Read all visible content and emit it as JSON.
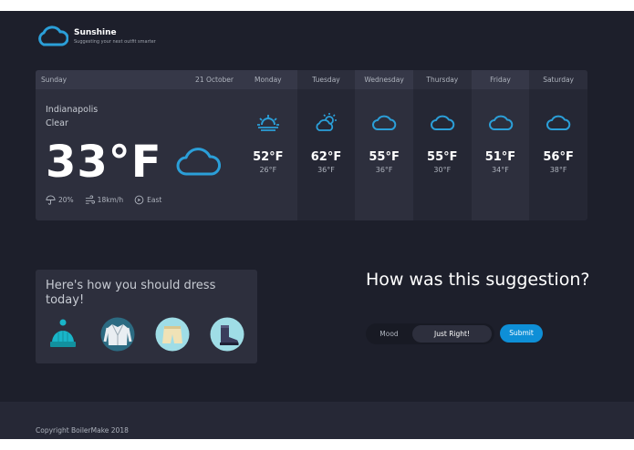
{
  "brand": {
    "title": "Sunshine",
    "subtitle": "Suggesting your next outfit smarter",
    "logo_icon": "cloud-icon",
    "accent_color": "#2b9fd8"
  },
  "today": {
    "day": "Sunday",
    "date": "21 October",
    "city": "Indianapolis",
    "condition": "Clear",
    "temperature": "33°F",
    "icon": "cloud-icon",
    "precipitation": "20%",
    "wind_speed": "18km/h",
    "wind_direction": "East"
  },
  "forecast": [
    {
      "day": "Monday",
      "icon": "sunrise-icon",
      "high": "52°F",
      "low": "26°F"
    },
    {
      "day": "Tuesday",
      "icon": "partly-sunny-icon",
      "high": "62°F",
      "low": "36°F"
    },
    {
      "day": "Wednesday",
      "icon": "cloud-icon",
      "high": "55°F",
      "low": "36°F"
    },
    {
      "day": "Thursday",
      "icon": "cloud-icon",
      "high": "55°F",
      "low": "30°F"
    },
    {
      "day": "Friday",
      "icon": "cloud-icon",
      "high": "51°F",
      "low": "34°F"
    },
    {
      "day": "Saturday",
      "icon": "cloud-icon",
      "high": "56°F",
      "low": "38°F"
    }
  ],
  "dress": {
    "title": "Here's how you should dress today!",
    "items": [
      "beanie-icon",
      "jacket-icon",
      "shorts-icon",
      "boot-icon"
    ]
  },
  "feedback": {
    "title": "How was this suggestion?",
    "mood_label": "Mood",
    "mood_value": "Just Right!",
    "submit_label": "Submit"
  },
  "footer": {
    "copyright": "Copyright BoilerMake 2018"
  }
}
